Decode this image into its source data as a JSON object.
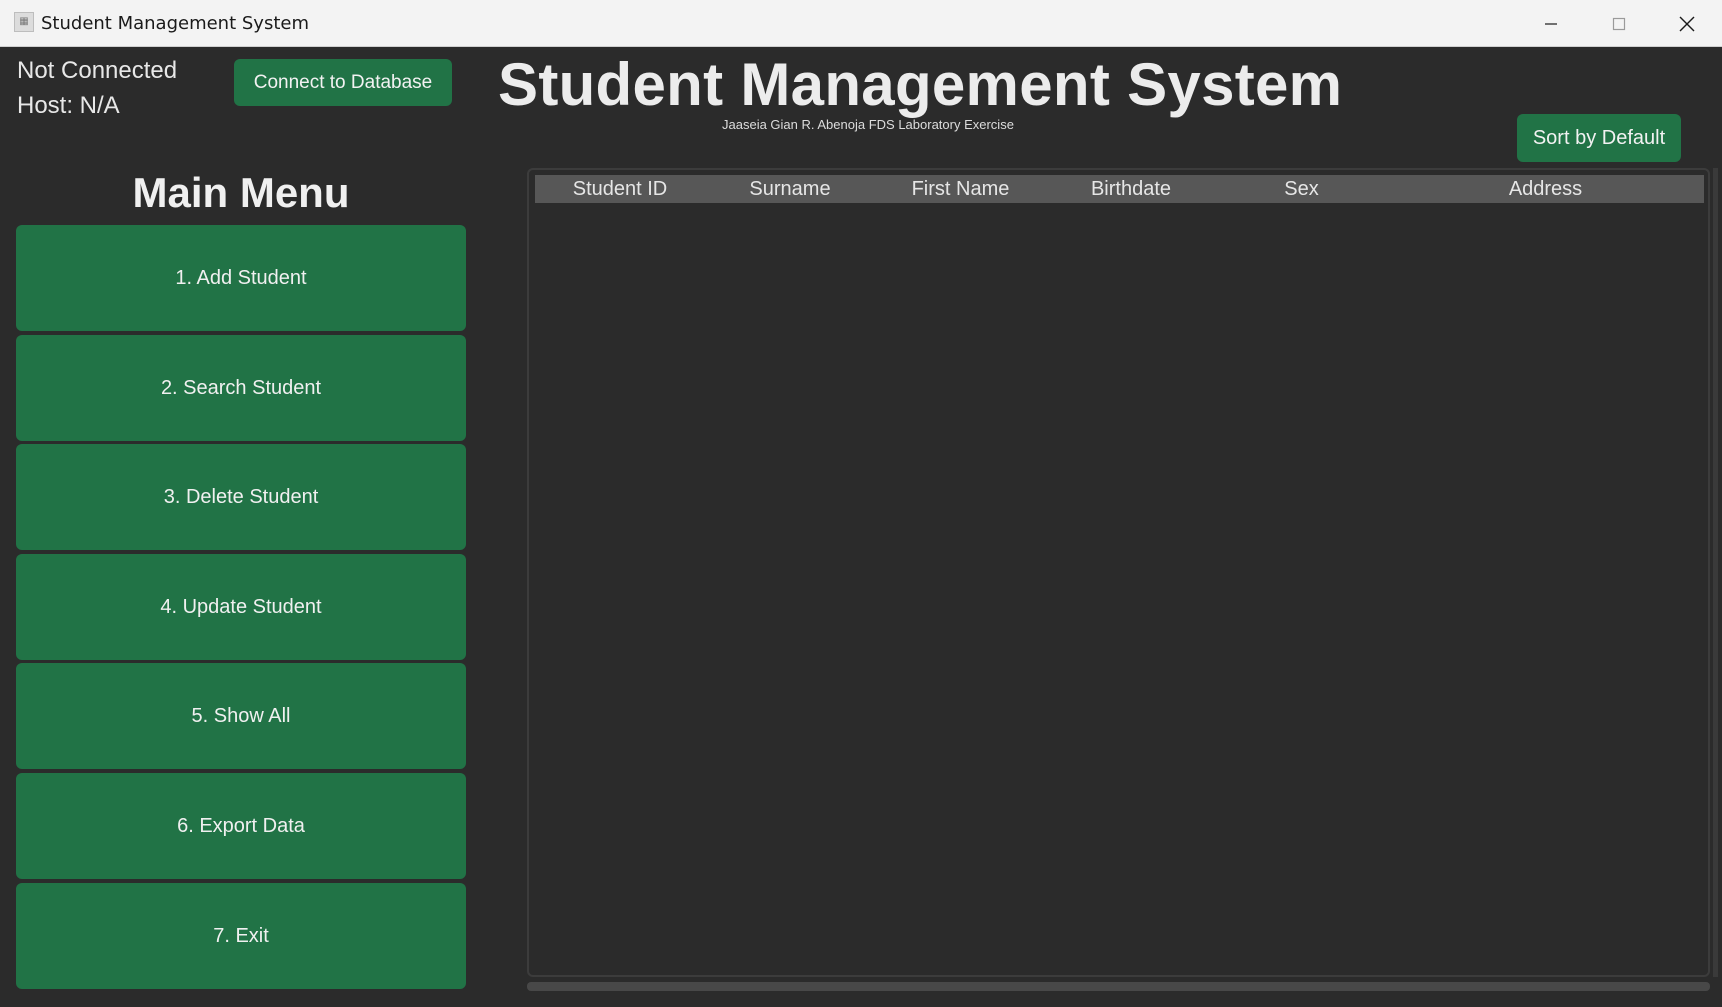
{
  "window": {
    "title": "Student Management System",
    "controls": [
      "minimize",
      "maximize",
      "close"
    ]
  },
  "status": {
    "connection": "Not Connected",
    "host": "Host: N/A"
  },
  "toolbar": {
    "connect_label": "Connect to Database",
    "sort_label": "Sort by Default"
  },
  "header": {
    "title": "Student Management System",
    "subtitle": "Jaaseia Gian R. Abenoja FDS Laboratory Exercise"
  },
  "menu": {
    "title": "Main Menu",
    "items": [
      {
        "label": "1. Add Student"
      },
      {
        "label": "2. Search Student"
      },
      {
        "label": "3. Delete Student"
      },
      {
        "label": "4. Update Student"
      },
      {
        "label": "5. Show All"
      },
      {
        "label": "6. Export Data"
      },
      {
        "label": "7. Exit"
      }
    ]
  },
  "table": {
    "columns": [
      "Student ID",
      "Surname",
      "First Name",
      "Birthdate",
      "Sex",
      "Address"
    ],
    "rows": []
  },
  "colors": {
    "accent_green": "#217346",
    "background": "#2b2b2b",
    "table_header": "#575757"
  }
}
